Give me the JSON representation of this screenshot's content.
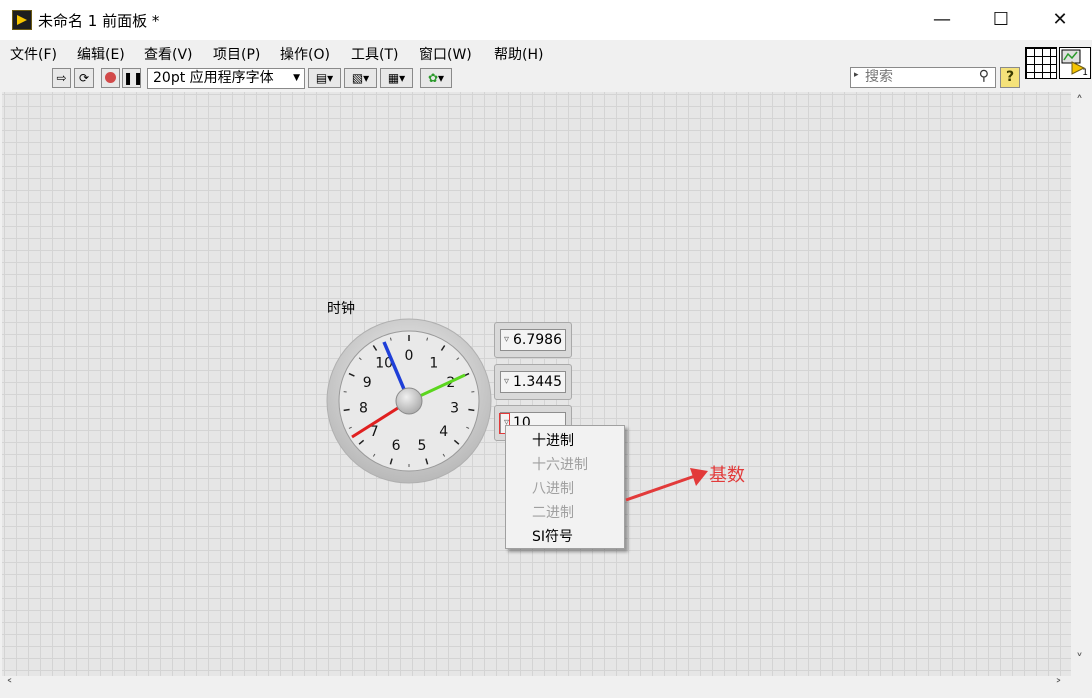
{
  "window": {
    "title": "未命名 1 前面板 *"
  },
  "menu": [
    "文件(F)",
    "编辑(E)",
    "查看(V)",
    "项目(P)",
    "操作(O)",
    "工具(T)",
    "窗口(W)",
    "帮助(H)"
  ],
  "toolbar": {
    "font": "20pt 应用程序字体",
    "search_placeholder": "搜索",
    "help": "?",
    "icon_number": "1"
  },
  "clock": {
    "label": "时钟",
    "dial_numbers": [
      "0",
      "1",
      "2",
      "3",
      "4",
      "5",
      "6",
      "7",
      "8",
      "9",
      "10"
    ]
  },
  "indicators": [
    {
      "value": "6.7986"
    },
    {
      "value": "1.3445"
    },
    {
      "value": "10"
    }
  ],
  "context_menu": {
    "items": [
      {
        "label": "十进制",
        "enabled": true
      },
      {
        "label": "十六进制",
        "enabled": false
      },
      {
        "label": "八进制",
        "enabled": false
      },
      {
        "label": "二进制",
        "enabled": false
      },
      {
        "label": "SI符号",
        "enabled": true
      }
    ]
  },
  "annotation": {
    "label": "基数",
    "color": "#e23a3a"
  }
}
